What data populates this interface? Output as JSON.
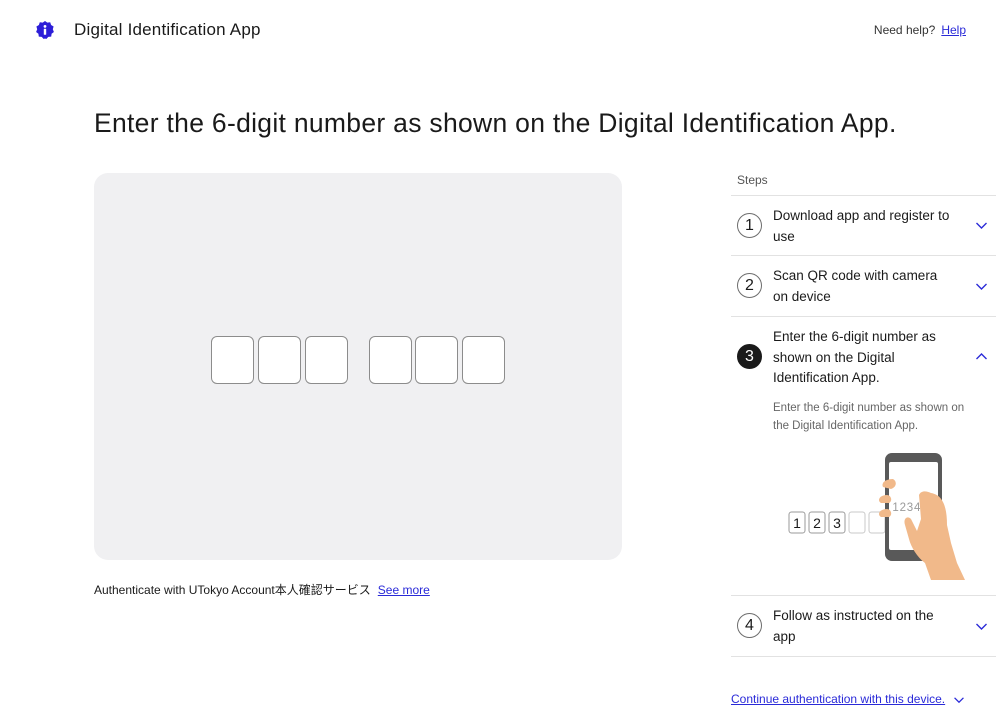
{
  "header": {
    "app_title": "Digital Identification App",
    "help_prompt": "Need help?",
    "help_link": "Help",
    "logo_icon": "shield-info-icon"
  },
  "main": {
    "title": "Enter the 6-digit number as shown on the Digital Identification App.",
    "code_inputs": [
      "",
      "",
      "",
      "",
      "",
      ""
    ],
    "auth_text": "Authenticate with UTokyo Account本人確認サービス",
    "see_more": "See more"
  },
  "steps": {
    "label": "Steps",
    "items": [
      {
        "number": "1",
        "title": "Download app and register to use",
        "expanded": false
      },
      {
        "number": "2",
        "title": "Scan QR code with camera on device",
        "expanded": false
      },
      {
        "number": "3",
        "title": "Enter the 6-digit number as shown on the Digital Identification App.",
        "expanded": true,
        "detail": "Enter the 6-digit number as shown on the Digital Identification App.",
        "illustration": {
          "boxes": [
            "1",
            "2",
            "3",
            "",
            ""
          ],
          "phone_code": "123456"
        }
      },
      {
        "number": "4",
        "title": "Follow as instructed on the app",
        "expanded": false
      }
    ]
  },
  "footer": {
    "continue_link": "Continue authentication with this device."
  },
  "colors": {
    "accent": "#2a2ad8",
    "panel": "#f0f0f2",
    "skin": "#f1b98a",
    "phone": "#595959"
  }
}
